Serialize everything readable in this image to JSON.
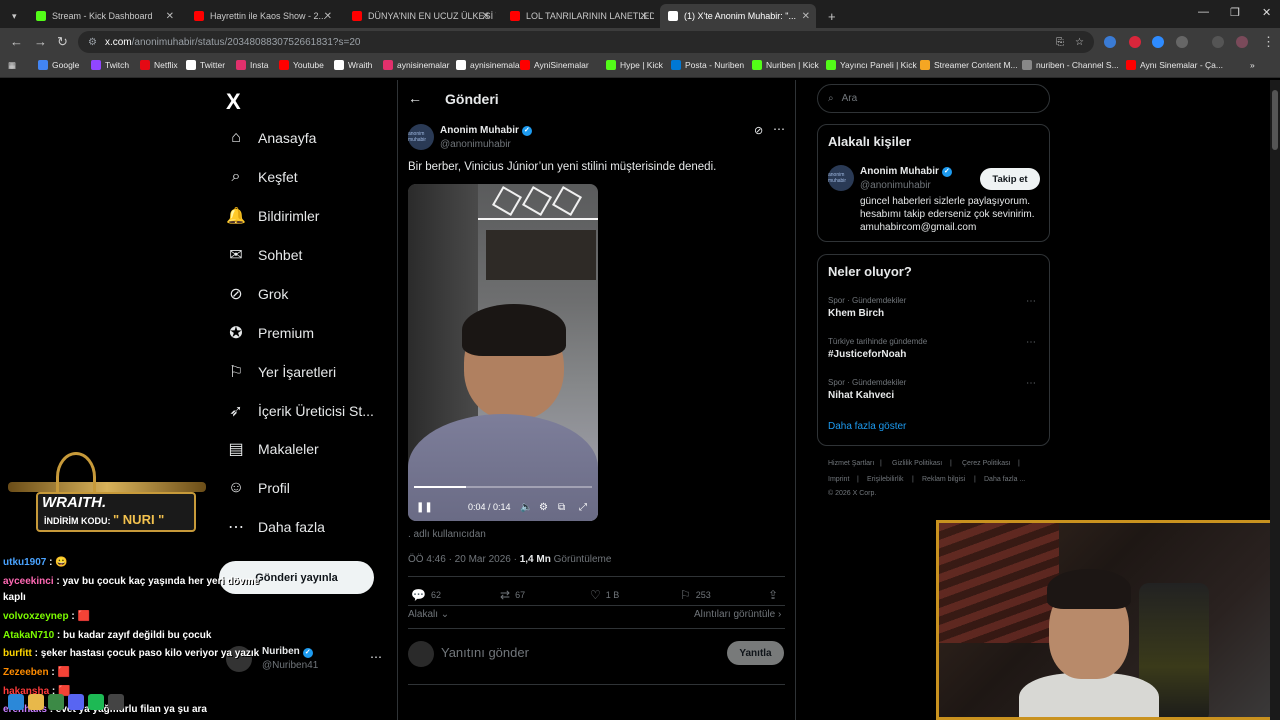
{
  "browser": {
    "tabs": [
      {
        "label": "Stream - Kick Dashboard",
        "color": "#53fc18"
      },
      {
        "label": "Hayrettin ile Kaos Show - 2...",
        "color": "#ff0000"
      },
      {
        "label": "DÜNYA'NIN EN UCUZ ÜLKESİ V...",
        "color": "#ff0000"
      },
      {
        "label": "LOL TANRILARININ LANETLEDİ...",
        "color": "#ff0000"
      },
      {
        "label": "(1) X'te Anonim Muhabir: \"...",
        "color": "#ffffff"
      }
    ],
    "new_tab": "+",
    "url_host": "x.com",
    "url_path": "/anonimuhabir/status/2034808830752661831?s=20",
    "bookmarks": [
      {
        "label": "Google",
        "color": "#4285f4"
      },
      {
        "label": "Twitch",
        "color": "#9146ff"
      },
      {
        "label": "Netflix",
        "color": "#e50914"
      },
      {
        "label": "Twitter",
        "color": "#ffffff"
      },
      {
        "label": "Insta",
        "color": "#e1306c"
      },
      {
        "label": "Youtube",
        "color": "#ff0000"
      },
      {
        "label": "Wraith",
        "color": "#ffffff"
      },
      {
        "label": "aynisinemalar",
        "color": "#e1306c"
      },
      {
        "label": "aynisinemalar",
        "color": "#ffffff"
      },
      {
        "label": "AyniSinemalar",
        "color": "#ff0000"
      },
      {
        "label": "Hype | Kick",
        "color": "#53fc18"
      },
      {
        "label": "Posta - Nuriben",
        "color": "#0078d4"
      },
      {
        "label": "Nuriben | Kick",
        "color": "#53fc18"
      },
      {
        "label": "Yayıncı Paneli | Kick",
        "color": "#53fc18"
      },
      {
        "label": "Streamer Content M...",
        "color": "#f5a623"
      },
      {
        "label": "nuriben - Channel S...",
        "color": "#888888"
      },
      {
        "label": "Aynı Sinemalar - Ça...",
        "color": "#ff0000"
      }
    ]
  },
  "left_nav": {
    "logo": "X",
    "items": [
      {
        "label": "Anasayfa",
        "icon": "home-icon",
        "glyph": "⌂"
      },
      {
        "label": "Keşfet",
        "icon": "search-icon",
        "glyph": "⌕"
      },
      {
        "label": "Bildirimler",
        "icon": "bell-icon",
        "glyph": "🔔"
      },
      {
        "label": "Sohbet",
        "icon": "envelope-icon",
        "glyph": "✉"
      },
      {
        "label": "Grok",
        "icon": "grok-icon",
        "glyph": "⊘"
      },
      {
        "label": "Premium",
        "icon": "premium-icon",
        "glyph": "✪"
      },
      {
        "label": "Yer İşaretleri",
        "icon": "bookmark-icon",
        "glyph": "⚐"
      },
      {
        "label": "İçerik Üreticisi St...",
        "icon": "rocket-icon",
        "glyph": "➶"
      },
      {
        "label": "Makaleler",
        "icon": "articles-icon",
        "glyph": "▤"
      },
      {
        "label": "Profil",
        "icon": "profile-icon",
        "glyph": "☺"
      },
      {
        "label": "Daha fazla",
        "icon": "more-icon",
        "glyph": "⋯"
      }
    ],
    "post_button": "Gönderi yayınla",
    "account": {
      "name": "Nuriben",
      "handle": "@Nuriben41",
      "more": "⋯"
    }
  },
  "main": {
    "header_title": "Gönderi",
    "author": {
      "name": "Anonim Muhabir",
      "handle": "@anonimuhabir",
      "avatar_text": "anonim muhabir"
    },
    "text": "Bir berber, Vinicius Júnior’un yeni stilini müşterisinde denedi.",
    "video": {
      "time": "0:04 / 0:14",
      "progress": 0.29
    },
    "source_note": ". adlı kullanıcıdan",
    "meta_time": "ÖÖ 4:46 · 20 Mar 2026 · ",
    "meta_views": "1,4 Mn",
    "meta_views_label": " Görüntüleme",
    "actions": {
      "replies": "62",
      "reposts": "67",
      "likes": "1 B",
      "bookmarks": "253"
    },
    "related": "Alakalı",
    "quotes": "Alıntıları görüntüle",
    "reply_placeholder": "Yanıtını gönder",
    "reply_button": "Yanıtla"
  },
  "right": {
    "search_placeholder": "Ara",
    "relevant_title": "Alakalı kişiler",
    "relevant_person": {
      "name": "Anonim Muhabir",
      "handle": "@anonimuhabir",
      "follow": "Takip et",
      "bio": "güncel haberleri sizlerle paylaşıyorum. hesabımı takip ederseniz çok sevinirim. amuhabircom@gmail.com"
    },
    "trends_title": "Neler oluyor?",
    "trends": [
      {
        "category": "Spor · Gündemdekiler",
        "name": "Khem Birch"
      },
      {
        "category": "Türkiye tarihinde gündemde",
        "name": "#JusticeforNoah"
      },
      {
        "category": "Spor · Gündemdekiler",
        "name": "Nihat Kahveci"
      }
    ],
    "show_more": "Daha fazla göster",
    "footer": [
      "Hizmet Şartları",
      "|",
      "Gizlilik Politikası",
      "|",
      "Çerez Politikası",
      "|",
      "Imprint",
      "|",
      "Erişilebilirlik",
      "|",
      "Reklam bilgisi",
      "|",
      "Daha fazla ...",
      "© 2026 X Corp."
    ]
  },
  "overlay": {
    "sponsor_brand": "WRAITH.",
    "sponsor_code_label": "İNDİRİM KODU:",
    "sponsor_code": "\" NURI \"",
    "chat": [
      {
        "user": "utku1907",
        "user_color": "#4aa3ff",
        "msg": " : 😀"
      },
      {
        "user": "ayceekinci",
        "user_color": "#ff69b4",
        "msg": " : yav bu çocuk kaç yaşında her yeri dövme"
      },
      {
        "user": "",
        "user_color": "#ffffff",
        "msg": "kaplı"
      },
      {
        "user": "volvoxzeynep",
        "user_color": "#7cfc00",
        "msg": " : 🟥"
      },
      {
        "user": "AtakaN710",
        "user_color": "#7cfc00",
        "msg": " : bu kadar zayıf değildi bu çocuk"
      },
      {
        "user": "burfitt",
        "user_color": "#ffd700",
        "msg": " : şeker hastası çocuk paso kilo veriyor ya yazık"
      },
      {
        "user": "Zezeeben",
        "user_color": "#ff8c00",
        "msg": " : 🟥"
      },
      {
        "user": "hakansha",
        "user_color": "#ff3b3b",
        "msg": " : 🟥"
      },
      {
        "user": "erenhaks",
        "user_color": "#c77dff",
        "msg": " : evet ya yağmurlu filan ya şu ara"
      }
    ]
  }
}
